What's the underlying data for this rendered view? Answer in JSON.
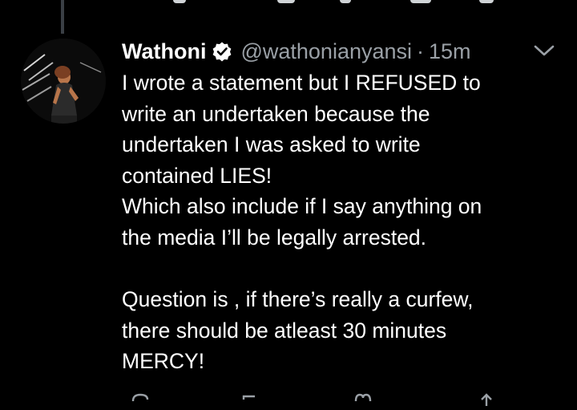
{
  "tweet": {
    "display_name": "Wathoni",
    "handle": "@wathonianyansi",
    "separator": "·",
    "time": "15m",
    "body": "I wrote a statement but I REFUSED to\nwrite an undertaken because the\nundertaken I was asked to write\ncontained LIES!\nWhich also include if I say anything on\nthe media I’ll be legally arrested.\n\nQuestion is , if there’s really a curfew,\nthere should be atleast 30 minutes\nMERCY!"
  },
  "icons": {
    "verified": "verified-badge-icon",
    "more": "chevron-down-icon",
    "reply": "reply-icon",
    "retweet": "retweet-icon",
    "like": "like-icon",
    "share": "share-icon"
  },
  "colors": {
    "background": "#000000",
    "text_primary": "#ffffff",
    "text_secondary": "#9aa0a6",
    "thread_line": "#3a3f45"
  }
}
